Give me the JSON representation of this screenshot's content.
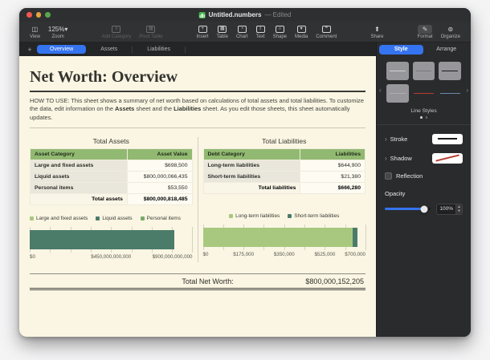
{
  "colors": {
    "accent": "#3574f0",
    "table_header": "#92b971",
    "canvas": "#faf6e3"
  },
  "window": {
    "title": "Untitled.numbers",
    "edited": "— Edited"
  },
  "toolbar": {
    "view": "View",
    "zoom": "Zoom",
    "zoom_value": "125%",
    "add_category": "Add Category",
    "pivot_table": "Pivot Table",
    "insert": "Insert",
    "table": "Table",
    "chart": "Chart",
    "text": "Text",
    "shape": "Shape",
    "media": "Media",
    "comment": "Comment",
    "share": "Share",
    "format": "Format",
    "organize": "Organize"
  },
  "tabs": {
    "overview": "Overview",
    "assets": "Assets",
    "liabilities": "Liabilities"
  },
  "sidebar": {
    "style_tab": "Style",
    "arrange_tab": "Arrange",
    "line_styles": "Line Styles",
    "stroke": "Stroke",
    "shadow": "Shadow",
    "reflection": "Reflection",
    "opacity": "Opacity",
    "opacity_value": "100%"
  },
  "sheet": {
    "title": "Net Worth: Overview",
    "howto_prefix": "HOW TO USE: This sheet shows a summary of net worth based on calculations of total assets and total liabilities. To customize the data, edit information on the ",
    "howto_bold1": "Assets",
    "howto_mid": " sheet and the ",
    "howto_bold2": "Liabilities",
    "howto_suffix": " sheet. As you edit those sheets, this sheet automatically updates.",
    "assets": {
      "title": "Total Assets",
      "headers": [
        "Asset Category",
        "Asset Value"
      ],
      "rows": [
        {
          "label": "Large and fixed assets",
          "value": "$698,500"
        },
        {
          "label": "Liquid assets",
          "value": "$800,000,066,435"
        },
        {
          "label": "Personal items",
          "value": "$53,550"
        }
      ],
      "total_label": "Total assets",
      "total_value": "$800,000,818,485"
    },
    "liabilities": {
      "title": "Total Liabilities",
      "headers": [
        "Debt Category",
        "Liabilities"
      ],
      "rows": [
        {
          "label": "Long-term liabilities",
          "value": "$644,900"
        },
        {
          "label": "Short-term liabilities",
          "value": "$21,380"
        }
      ],
      "total_label": "Total liabilities",
      "total_value": "$666,280"
    },
    "net_worth": {
      "label": "Total Net Worth:",
      "value": "$800,000,152,205"
    }
  },
  "chart_data": [
    {
      "type": "bar",
      "orientation": "horizontal",
      "series": [
        {
          "name": "Large and fixed assets",
          "value": 698500,
          "color": "#a9c87f"
        },
        {
          "name": "Liquid assets",
          "value": 800000066435,
          "color": "#4b7b69"
        },
        {
          "name": "Personal items",
          "value": 53550,
          "color": "#7cab68"
        }
      ],
      "xmax": 900000000000,
      "tick_labels": [
        "$0",
        "$450,000,000,000",
        "$900,000,000,000"
      ],
      "legend_position": "top",
      "grid": true
    },
    {
      "type": "bar",
      "orientation": "horizontal",
      "stacked": true,
      "series": [
        {
          "name": "Long-term liabilities",
          "value": 644900,
          "color": "#a9c87f"
        },
        {
          "name": "Short-term liabilities",
          "value": 21380,
          "color": "#4b7b69"
        }
      ],
      "xmax": 700000,
      "tick_labels": [
        "$0",
        "$175,000",
        "$350,000",
        "$525,000",
        "$700,000"
      ],
      "legend_position": "top",
      "grid": true
    }
  ]
}
